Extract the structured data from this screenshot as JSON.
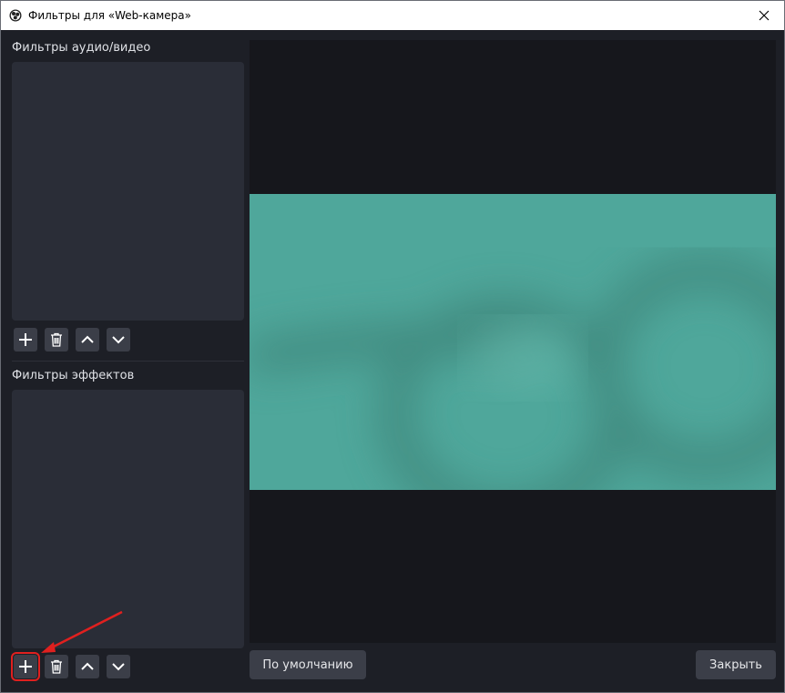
{
  "window": {
    "title": "Фильтры для «Web-камера»"
  },
  "audio_video_filters": {
    "label": "Фильтры аудио/видео",
    "items": []
  },
  "effect_filters": {
    "label": "Фильтры эффектов",
    "items": []
  },
  "toolbar": {
    "add": "add-icon",
    "remove": "trash-icon",
    "move_up": "chevron-up-icon",
    "move_down": "chevron-down-icon"
  },
  "footer": {
    "defaults_label": "По умолчанию",
    "close_label": "Закрыть"
  },
  "colors": {
    "accent_highlight": "#e0201f",
    "preview_bg": "#16171c",
    "camera_color": "#4fa79b"
  }
}
